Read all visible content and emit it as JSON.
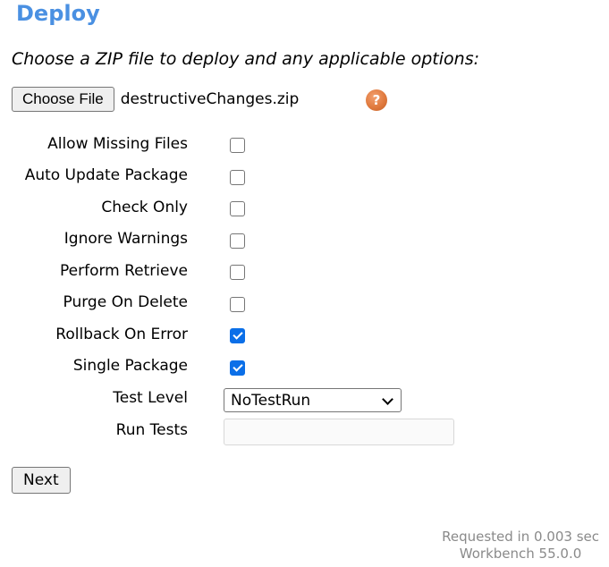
{
  "page": {
    "title": "Deploy",
    "instructions": "Choose a ZIP file to deploy and any applicable options:"
  },
  "file_picker": {
    "button_label": "Choose File",
    "file_name": "destructiveChanges.zip",
    "help_icon": "?"
  },
  "options": [
    {
      "label": "Allow Missing Files",
      "checked": false
    },
    {
      "label": "Auto Update Package",
      "checked": false
    },
    {
      "label": "Check Only",
      "checked": false
    },
    {
      "label": "Ignore Warnings",
      "checked": false
    },
    {
      "label": "Perform Retrieve",
      "checked": false
    },
    {
      "label": "Purge On Delete",
      "checked": false
    },
    {
      "label": "Rollback On Error",
      "checked": true
    },
    {
      "label": "Single Package",
      "checked": true
    }
  ],
  "test_level": {
    "label": "Test Level",
    "selected": "NoTestRun"
  },
  "run_tests": {
    "label": "Run Tests",
    "value": ""
  },
  "actions": {
    "next_label": "Next"
  },
  "footer": {
    "timing": "Requested in 0.003 sec",
    "version": "Workbench 55.0.0"
  },
  "colors": {
    "title": "#4a90e2",
    "checkbox_checked": "#0b6fe8",
    "help_icon": "#e07a3e",
    "footer_text": "#8a8a8a"
  }
}
